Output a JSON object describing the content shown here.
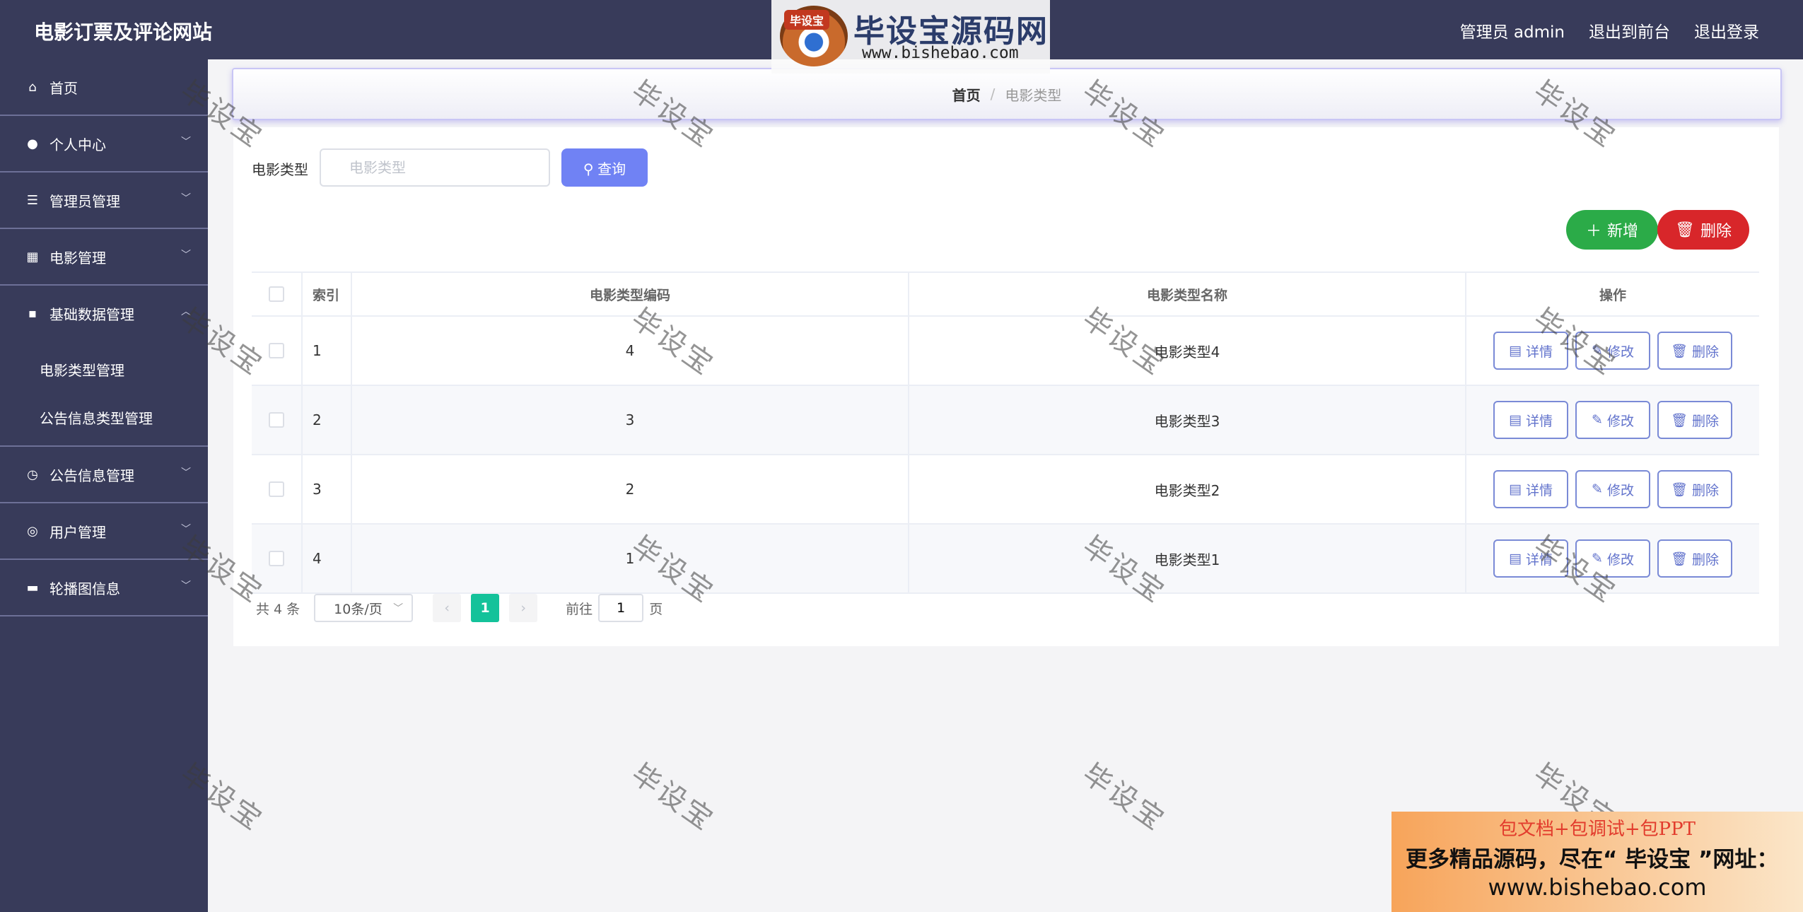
{
  "header": {
    "site_title": "电影订票及评论网站",
    "user_label": "管理员 admin",
    "front_link": "退出到前台",
    "logout_link": "退出登录"
  },
  "logo": {
    "badge": "毕设宝",
    "name": "毕设宝源码网",
    "url": "www.bishebao.com"
  },
  "sidebar": {
    "items": [
      {
        "label": "首页",
        "icon": "home-icon",
        "has_children": false
      },
      {
        "label": "个人中心",
        "icon": "user-icon",
        "has_children": true
      },
      {
        "label": "管理员管理",
        "icon": "list-icon",
        "has_children": true
      },
      {
        "label": "电影管理",
        "icon": "grid-icon",
        "has_children": true
      },
      {
        "label": "基础数据管理",
        "icon": "message-icon",
        "has_children": true,
        "expanded": true,
        "children": [
          {
            "label": "电影类型管理"
          },
          {
            "label": "公告信息类型管理"
          }
        ]
      },
      {
        "label": "公告信息管理",
        "icon": "clock-icon",
        "has_children": true
      },
      {
        "label": "用户管理",
        "icon": "circle-icon",
        "has_children": true
      },
      {
        "label": "轮播图信息",
        "icon": "monitor-icon",
        "has_children": true
      }
    ]
  },
  "breadcrumb": {
    "home": "首页",
    "separator": "/",
    "current": "电影类型"
  },
  "search": {
    "label": "电影类型",
    "placeholder": "电影类型",
    "query_button": "查询"
  },
  "actions": {
    "add": "新增",
    "delete": "删除"
  },
  "table": {
    "headers": {
      "index": "索引",
      "code": "电影类型编码",
      "name": "电影类型名称",
      "ops": "操作"
    },
    "op_labels": {
      "detail": "详情",
      "edit": "修改",
      "delete": "删除"
    },
    "rows": [
      {
        "index": "1",
        "code": "4",
        "name": "电影类型4"
      },
      {
        "index": "2",
        "code": "3",
        "name": "电影类型3"
      },
      {
        "index": "3",
        "code": "2",
        "name": "电影类型2"
      },
      {
        "index": "4",
        "code": "1",
        "name": "电影类型1"
      }
    ]
  },
  "pagination": {
    "total": "共 4 条",
    "page_size": "10条/页",
    "current_page": "1",
    "goto_label": "前往",
    "goto_value": "1",
    "page_unit": "页"
  },
  "watermark": {
    "text": "毕设宝"
  },
  "ad": {
    "line1": "包文档+包调试+包PPT",
    "line2": "更多精品源码，尽在“ 毕设宝 ”网址：",
    "line3": "www.bishebao.com"
  },
  "colors": {
    "sidebar_bg": "#383b5a",
    "query_button": "#7082f4",
    "add_button": "#2bab48",
    "delete_button": "#d8262a",
    "active_page": "#14c29a"
  }
}
